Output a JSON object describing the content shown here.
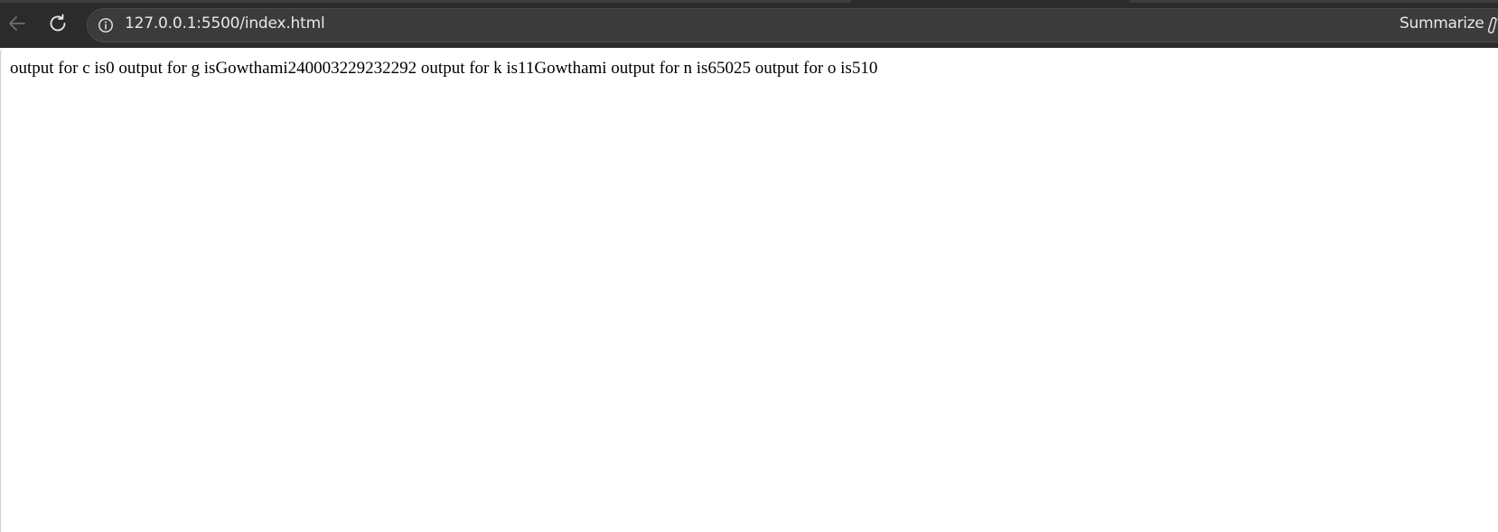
{
  "address_bar": {
    "url": "127.0.0.1:5500/index.html"
  },
  "toolbar": {
    "summarize_label": "Summarize",
    "icons": {
      "back": "arrow-left-icon",
      "reload": "reload-icon",
      "site_info": "info-icon",
      "summarize": "copilot-summarize-icon"
    }
  },
  "page": {
    "body_text": "output for c is0 output for g isGowthami240003229232292 output for k is11Gowthami output for n is65025 output for o is510"
  },
  "colors": {
    "toolbar_bg": "#2b2b2b",
    "address_bg": "#3b3b3b",
    "toolbar_text": "#e8e8e8",
    "page_bg": "#ffffff",
    "page_text": "#000000"
  }
}
